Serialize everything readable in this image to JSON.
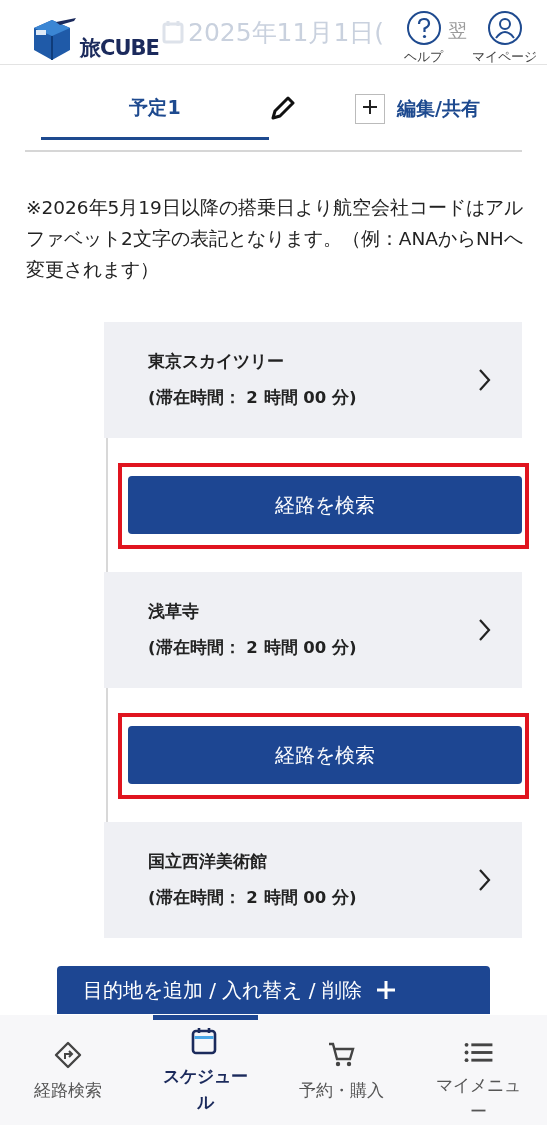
{
  "header": {
    "logo": "旅CUBE",
    "date": "2025年11月1日(",
    "next_day": "翌",
    "actions": [
      {
        "kind": "help",
        "label": "ヘルプ"
      },
      {
        "kind": "user",
        "label": "マイページ"
      }
    ]
  },
  "plan_tabs": {
    "tabs": [
      {
        "label": "予定1",
        "selected": true
      }
    ],
    "edit_label": "編集/共有"
  },
  "notice": "※2026年5月19日以降の搭乗日より航空会社コードはアルファベット2文字の表記となります。（例：ANAからNHへ変更されます）",
  "schedule": [
    {
      "kind": "place",
      "name": "東京スカイツリー",
      "stay": "(滞在時間： 2 時間 00 分)"
    },
    {
      "kind": "route",
      "label": "経路を検索",
      "highlighted": true
    },
    {
      "kind": "place",
      "name": "浅草寺",
      "stay": "(滞在時間： 2 時間 00 分)"
    },
    {
      "kind": "route",
      "label": "経路を検索",
      "highlighted": true
    },
    {
      "kind": "place",
      "name": "国立西洋美術館",
      "stay": "(滞在時間： 2 時間 00 分)"
    }
  ],
  "floating_button": "目的地を追加 / 入れ替え / 削除",
  "bottom_nav": [
    {
      "kind": "route",
      "label": "経路検索",
      "selected": false
    },
    {
      "kind": "calendar",
      "label": "スケジュール",
      "selected": true
    },
    {
      "kind": "cart",
      "label": "予約・購入",
      "selected": false
    },
    {
      "kind": "menu",
      "label": "マイメニュー",
      "selected": false
    }
  ]
}
